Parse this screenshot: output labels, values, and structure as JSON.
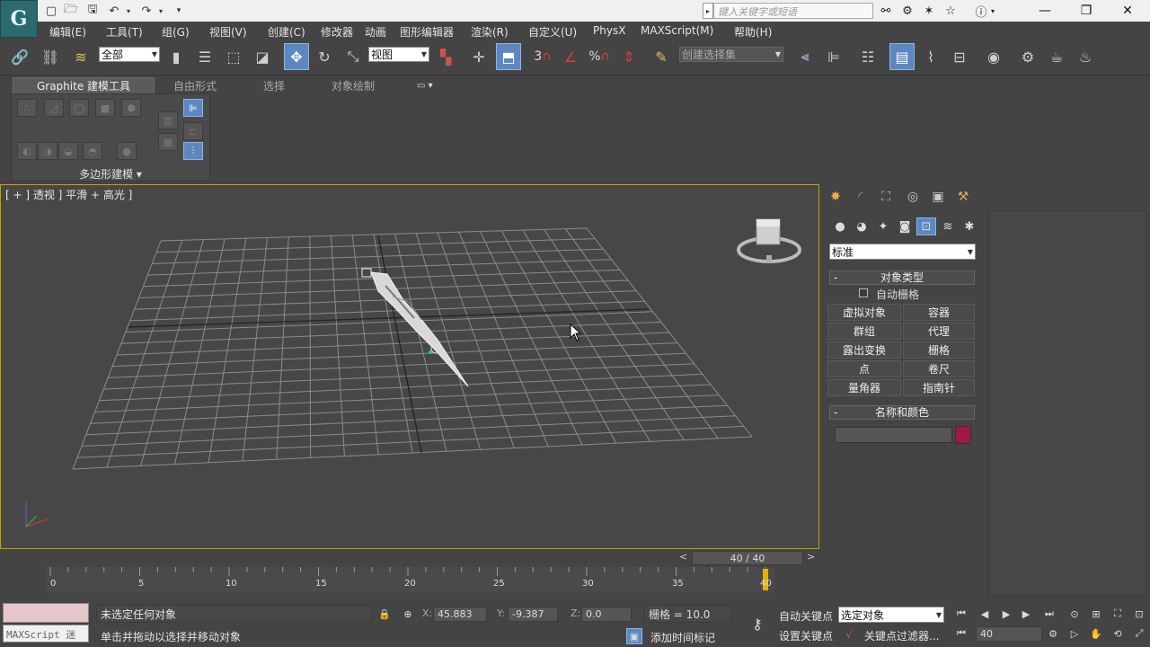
{
  "titlebar": {
    "logo_glyph": "G",
    "search_placeholder": "键入关键字或短语",
    "search_arrow": "▸"
  },
  "menu": {
    "items": [
      "编辑(E)",
      "工具(T)",
      "组(G)",
      "视图(V)",
      "创建(C)",
      "修改器",
      "动画",
      "图形编辑器",
      "渲染(R)",
      "自定义(U)",
      "PhysX",
      "MAXScript(M)",
      "帮助(H)"
    ]
  },
  "toolbar": {
    "selection_filter": "全部",
    "ref_coord": "视图",
    "named_selection": "创建选择集",
    "snap_label": "3",
    "angle_snap_glyph": "%"
  },
  "ribbon": {
    "tabs": [
      "Graphite 建模工具",
      "自由形式",
      "选择",
      "对象绘制"
    ],
    "panel_label": "多边形建模 ▾",
    "tab_extra": "▭ ▾"
  },
  "viewport": {
    "label": "[ + ] 透视 ] 平滑 + 高光 ]",
    "frame_counter": "40 / 40",
    "prev_frame": "<",
    "next_frame": ">"
  },
  "command_panel": {
    "category": "标准",
    "rollout_object_type": "对象类型",
    "autogrid_label": "自动栅格",
    "buttons": [
      "虚拟对象",
      "容器",
      "群组",
      "代理",
      "露出变换",
      "栅格",
      "点",
      "卷尺",
      "量角器",
      "指南针"
    ],
    "rollout_name_color": "名称和颜色",
    "name_value": "",
    "object_color": "#a0174a",
    "collapse_glyph": "-"
  },
  "timeline": {
    "ticks": [
      "0",
      "5",
      "10",
      "15",
      "20",
      "25",
      "30",
      "35",
      "40"
    ],
    "current_frame": 40
  },
  "status": {
    "maxscript_label": "MAXScript 迷",
    "line1": "未选定任何对象",
    "line2": "单击并拖动以选择并移动对象",
    "x_label": "X:",
    "x_value": "45.883",
    "y_label": "Y:",
    "y_value": "-9.387",
    "z_label": "Z:",
    "z_value": "0.0",
    "grid_label": "栅格 = 10.0",
    "add_time_tag": "添加时间标记",
    "auto_key": "自动关键点",
    "set_key": "设置关键点",
    "key_mode": "选定对象",
    "key_filters": "关键点过滤器...",
    "frame_field": "40"
  },
  "colors": {
    "accent": "#5c88c2",
    "viewport_border": "#c8a000",
    "maxscript_bg": "#e6c7c9"
  }
}
